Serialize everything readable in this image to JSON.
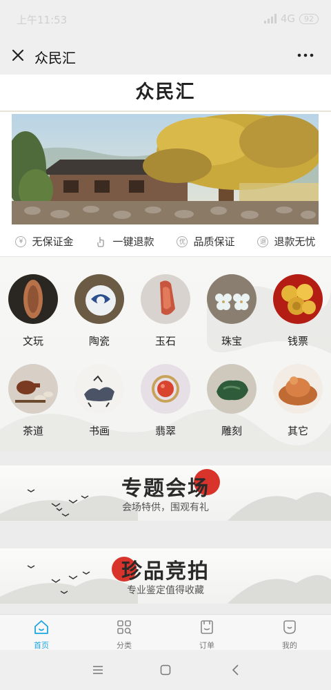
{
  "status_bar": {
    "time": "上午11:53",
    "network": "4G",
    "battery": "92"
  },
  "nav": {
    "title": "众民汇"
  },
  "header": {
    "title": "众民汇"
  },
  "guarantees": [
    {
      "label": "无保证金",
      "icon": "yen-icon"
    },
    {
      "label": "一键退款",
      "icon": "tap-icon"
    },
    {
      "label": "品质保证",
      "icon": "quality-icon"
    },
    {
      "label": "退款无忧",
      "icon": "refund-icon"
    }
  ],
  "categories": [
    {
      "label": "文玩"
    },
    {
      "label": "陶瓷"
    },
    {
      "label": "玉石"
    },
    {
      "label": "珠宝"
    },
    {
      "label": "钱票"
    },
    {
      "label": "茶道"
    },
    {
      "label": "书画"
    },
    {
      "label": "翡翠"
    },
    {
      "label": "雕刻"
    },
    {
      "label": "其它"
    }
  ],
  "promos": [
    {
      "title": "专题会场",
      "subtitle": "会场特供，围观有礼"
    },
    {
      "title": "珍品竞拍",
      "subtitle": "专业鉴定值得收藏"
    }
  ],
  "tabs": [
    {
      "label": "首页",
      "icon": "home-icon",
      "active": true
    },
    {
      "label": "分类",
      "icon": "category-icon",
      "active": false
    },
    {
      "label": "订单",
      "icon": "order-icon",
      "active": false
    },
    {
      "label": "我的",
      "icon": "profile-icon",
      "active": false
    }
  ],
  "colors": {
    "accent": "#1aa6e0",
    "seal_red": "#d9342b"
  }
}
